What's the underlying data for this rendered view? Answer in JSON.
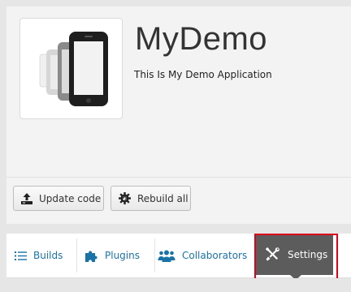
{
  "app": {
    "title": "MyDemo",
    "description": "This Is My Demo Application",
    "icon": "phonegap-app-icon"
  },
  "actions": {
    "update_label": "Update code",
    "update_icon": "upload-icon",
    "rebuild_label": "Rebuild all",
    "rebuild_icon": "rebuild-gear-icon"
  },
  "tabs": [
    {
      "label": "Builds",
      "icon": "list-icon",
      "active": false
    },
    {
      "label": "Plugins",
      "icon": "puzzle-icon",
      "active": false
    },
    {
      "label": "Collaborators",
      "icon": "users-icon",
      "active": false
    },
    {
      "label": "Settings",
      "icon": "wrench-screwdriver-icon",
      "active": true
    }
  ],
  "colors": {
    "tab_text": "#1a73a8",
    "active_tab_bg": "#5c5c5c",
    "highlight": "#e0001a",
    "page_bg": "#e6e6e6"
  }
}
